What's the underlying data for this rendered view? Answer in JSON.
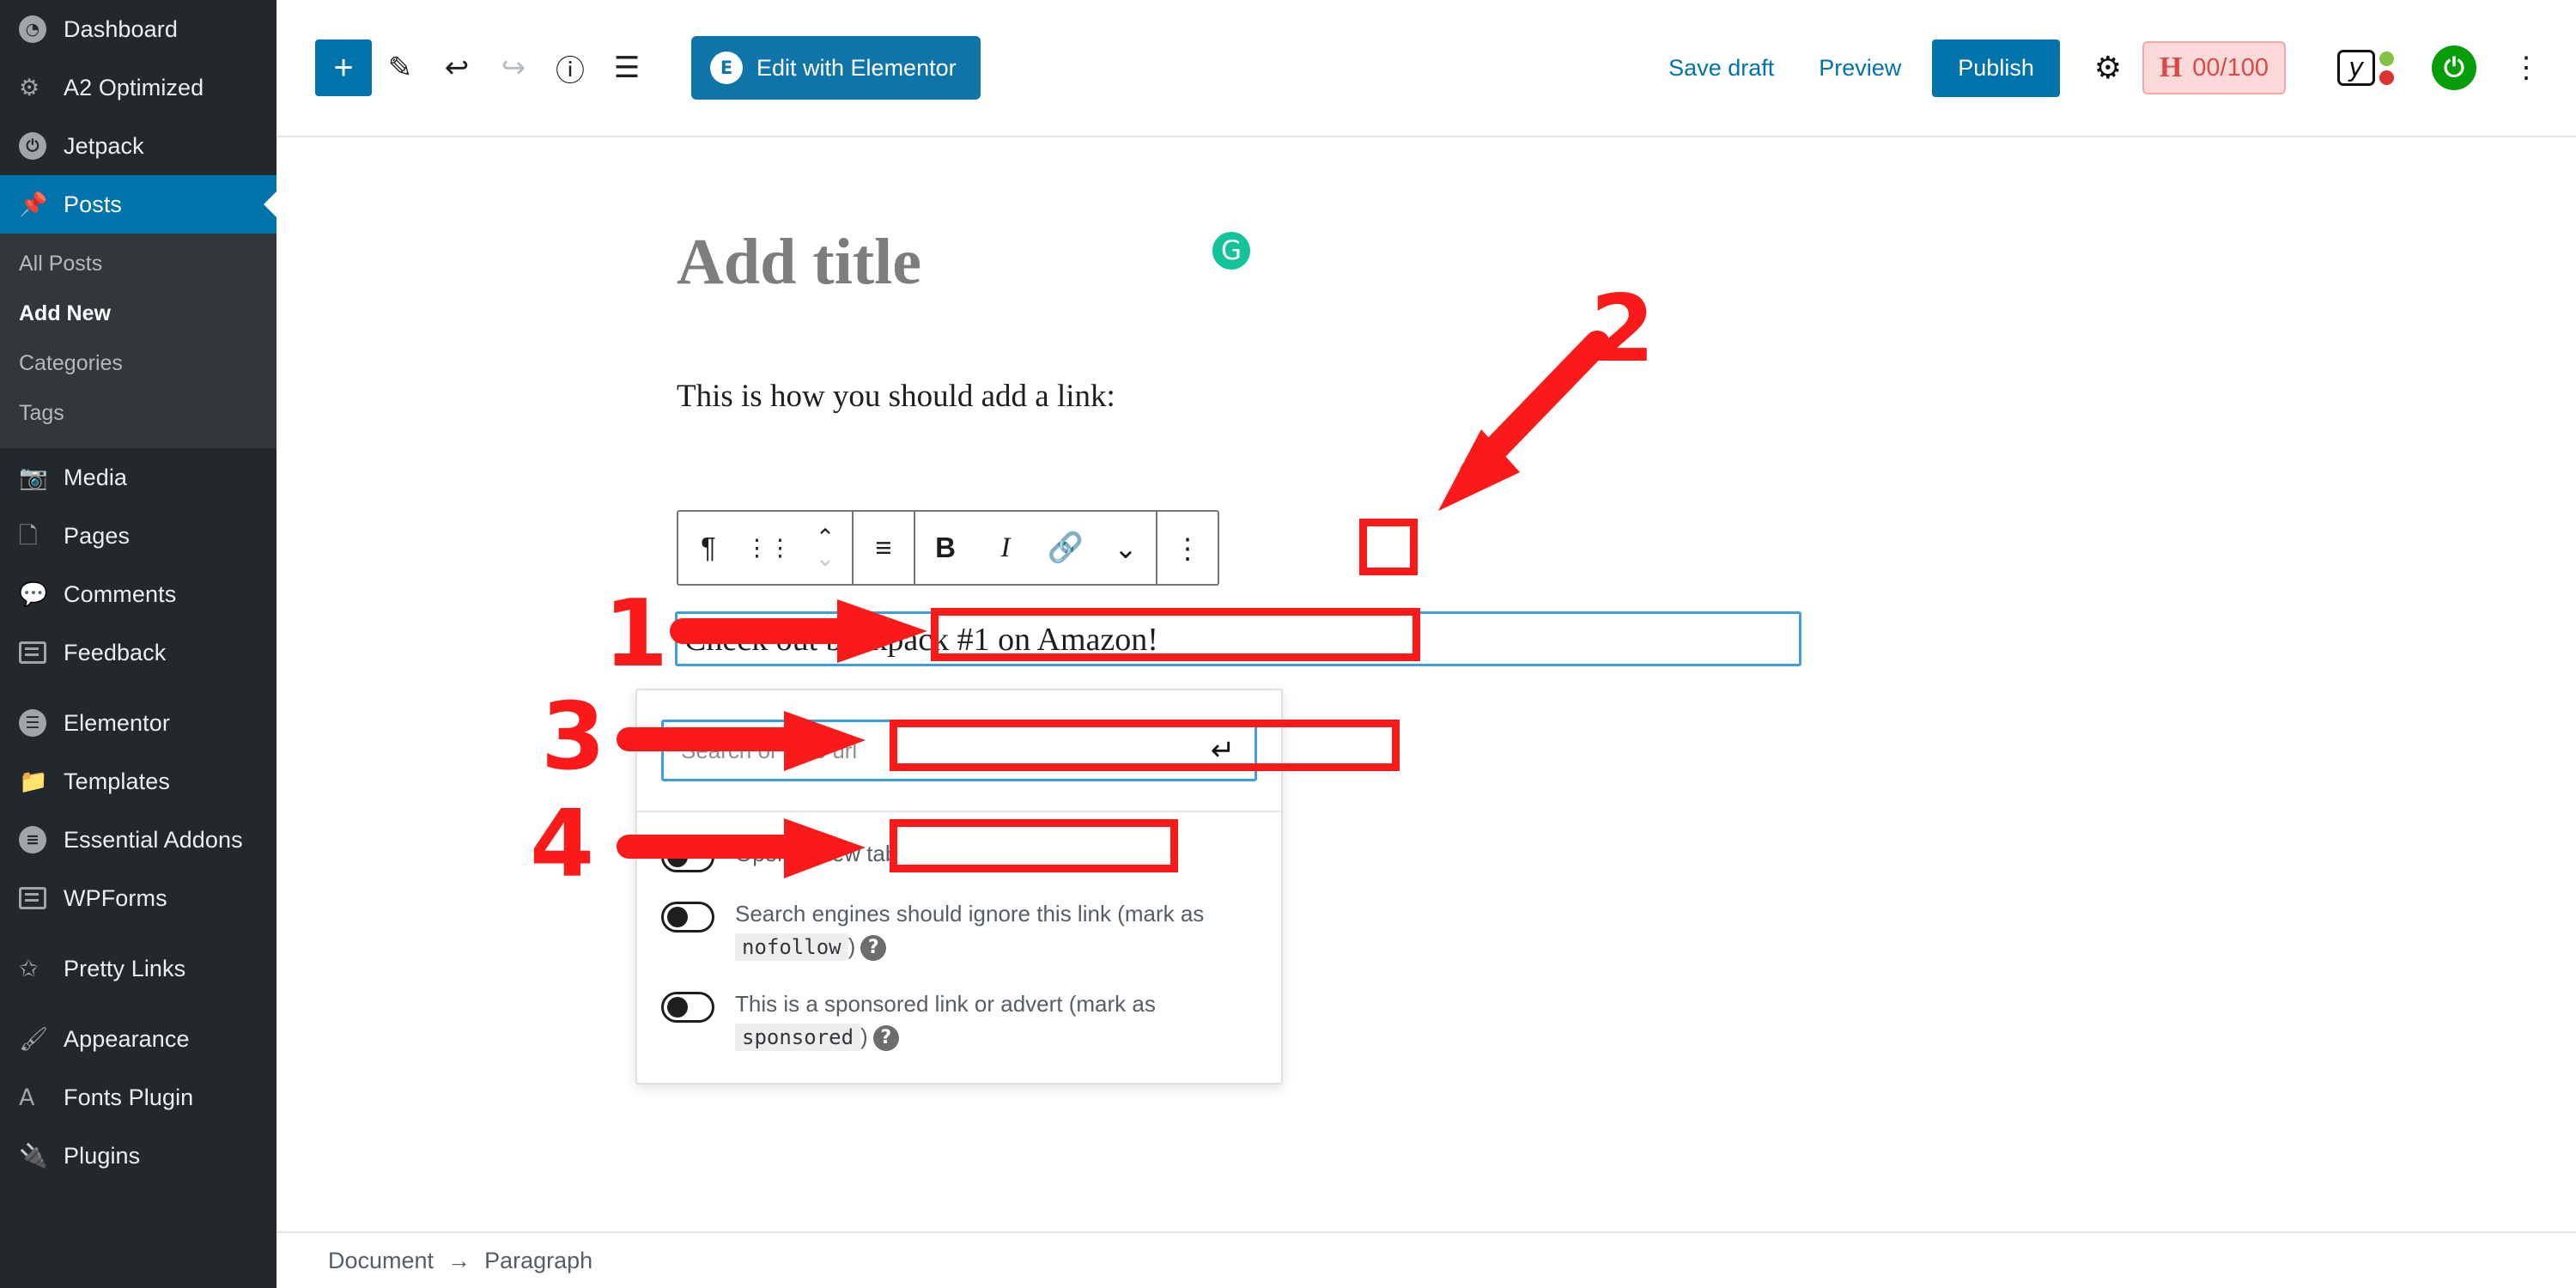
{
  "sidebar": {
    "top_items": [
      {
        "label": "Dashboard",
        "icon": "dashboard-icon"
      },
      {
        "label": "A2 Optimized",
        "icon": "gear-icon"
      },
      {
        "label": "Jetpack",
        "icon": "jetpack-icon"
      }
    ],
    "active_item": {
      "label": "Posts",
      "icon": "pin-icon"
    },
    "submenu": [
      {
        "label": "All Posts",
        "current": false
      },
      {
        "label": "Add New",
        "current": true
      },
      {
        "label": "Categories",
        "current": false
      },
      {
        "label": "Tags",
        "current": false
      }
    ],
    "group_two": [
      {
        "label": "Media",
        "icon": "media-icon"
      },
      {
        "label": "Pages",
        "icon": "pages-icon"
      },
      {
        "label": "Comments",
        "icon": "comment-icon"
      },
      {
        "label": "Feedback",
        "icon": "feedback-icon"
      }
    ],
    "group_three": [
      {
        "label": "Elementor",
        "icon": "elementor-icon"
      },
      {
        "label": "Templates",
        "icon": "folder-icon"
      },
      {
        "label": "Essential Addons",
        "icon": "essential-addons-icon"
      },
      {
        "label": "WPForms",
        "icon": "wpforms-icon"
      }
    ],
    "group_four": [
      {
        "label": "Pretty Links",
        "icon": "pretty-links-icon"
      }
    ],
    "group_five": [
      {
        "label": "Appearance",
        "icon": "brush-icon"
      },
      {
        "label": "Fonts Plugin",
        "icon": "font-a-icon"
      },
      {
        "label": "Plugins",
        "icon": "plug-icon"
      }
    ],
    "active_color": "#0073aa",
    "background": "#23282d",
    "submenu_background": "#32373c"
  },
  "topbar": {
    "add_block_label": "+",
    "tools": [
      {
        "name": "add-block-button",
        "glyph": "+"
      },
      {
        "name": "edit-tool-button",
        "glyph": "✎"
      },
      {
        "name": "undo-button",
        "glyph": "↩"
      },
      {
        "name": "redo-button",
        "glyph": "↪"
      },
      {
        "name": "details-info-button",
        "glyph": "ⓘ"
      },
      {
        "name": "block-navigation-button",
        "glyph": "☰"
      }
    ],
    "elementor_button": "Edit with Elementor",
    "elementor_logo_letter": "E",
    "save_draft": "Save draft",
    "preview": "Preview",
    "publish": "Publish",
    "settings_icon": "gear-icon",
    "yoast_score": {
      "letter": "H",
      "value": "00/100",
      "border_color": "#f3a8a8",
      "background": "#fbd9d9",
      "text_color": "#d84a4a"
    },
    "yoast_icon_letter": "y",
    "yoast_dot_colors": [
      "#82c341",
      "#dc3232"
    ],
    "jetpack_icon": "jetpack-icon",
    "jetpack_color": "#069e08",
    "more_menu_icon": "kebab-menu-icon",
    "accent_color": "#0073aa"
  },
  "editor": {
    "title_placeholder": "Add title",
    "grammarly_icon": "grammarly-icon",
    "grammarly_color": "#15c39a",
    "paragraph_intro": "This is how you should add a link:",
    "paragraph_selected": "Check out backpack #1 on Amazon!",
    "selection_color": "#3ca0dd"
  },
  "block_toolbar": {
    "buttons": [
      {
        "name": "block-type-paragraph-icon",
        "glyph": "¶"
      },
      {
        "name": "drag-handle-icon",
        "glyph": "∷"
      },
      {
        "name": "move-up-down-icon",
        "glyph": "⌃⌄"
      },
      {
        "name": "align-text-icon",
        "glyph": "≡"
      },
      {
        "name": "bold-button",
        "glyph": "B"
      },
      {
        "name": "italic-button",
        "glyph": "I"
      },
      {
        "name": "link-button",
        "glyph": "🔗"
      },
      {
        "name": "more-rich-text-chevron-icon",
        "glyph": "∨"
      },
      {
        "name": "block-options-kebab-icon",
        "glyph": "⋮"
      }
    ],
    "link_button_color": "#0a77bb"
  },
  "link_popover": {
    "search_placeholder": "Search or type url",
    "search_value": "",
    "submit_icon": "enter-arrow-icon",
    "options": [
      {
        "id": "open-in-new-tab",
        "text_before": "Open in new tab",
        "code": "",
        "text_after": "",
        "has_help": false,
        "enabled": false
      },
      {
        "id": "nofollow",
        "text_before": "Search engines should ignore this link (mark as",
        "code": "nofollow",
        "text_after": ")",
        "has_help": true,
        "enabled": false
      },
      {
        "id": "sponsored",
        "text_before": "This is a sponsored link or advert (mark as",
        "code": "sponsored",
        "text_after": ")",
        "has_help": true,
        "enabled": false
      }
    ],
    "help_glyph": "?"
  },
  "bottombar": {
    "breadcrumb_root": "Document",
    "breadcrumb_separator": "→",
    "breadcrumb_leaf": "Paragraph"
  },
  "annotations": {
    "color": "#fa1a1a",
    "steps": [
      {
        "number": "1",
        "target": "selected-paragraph-text"
      },
      {
        "number": "2",
        "target": "link-toolbar-button"
      },
      {
        "number": "3",
        "target": "link-search-input"
      },
      {
        "number": "4",
        "target": "open-in-new-tab-toggle"
      }
    ]
  }
}
